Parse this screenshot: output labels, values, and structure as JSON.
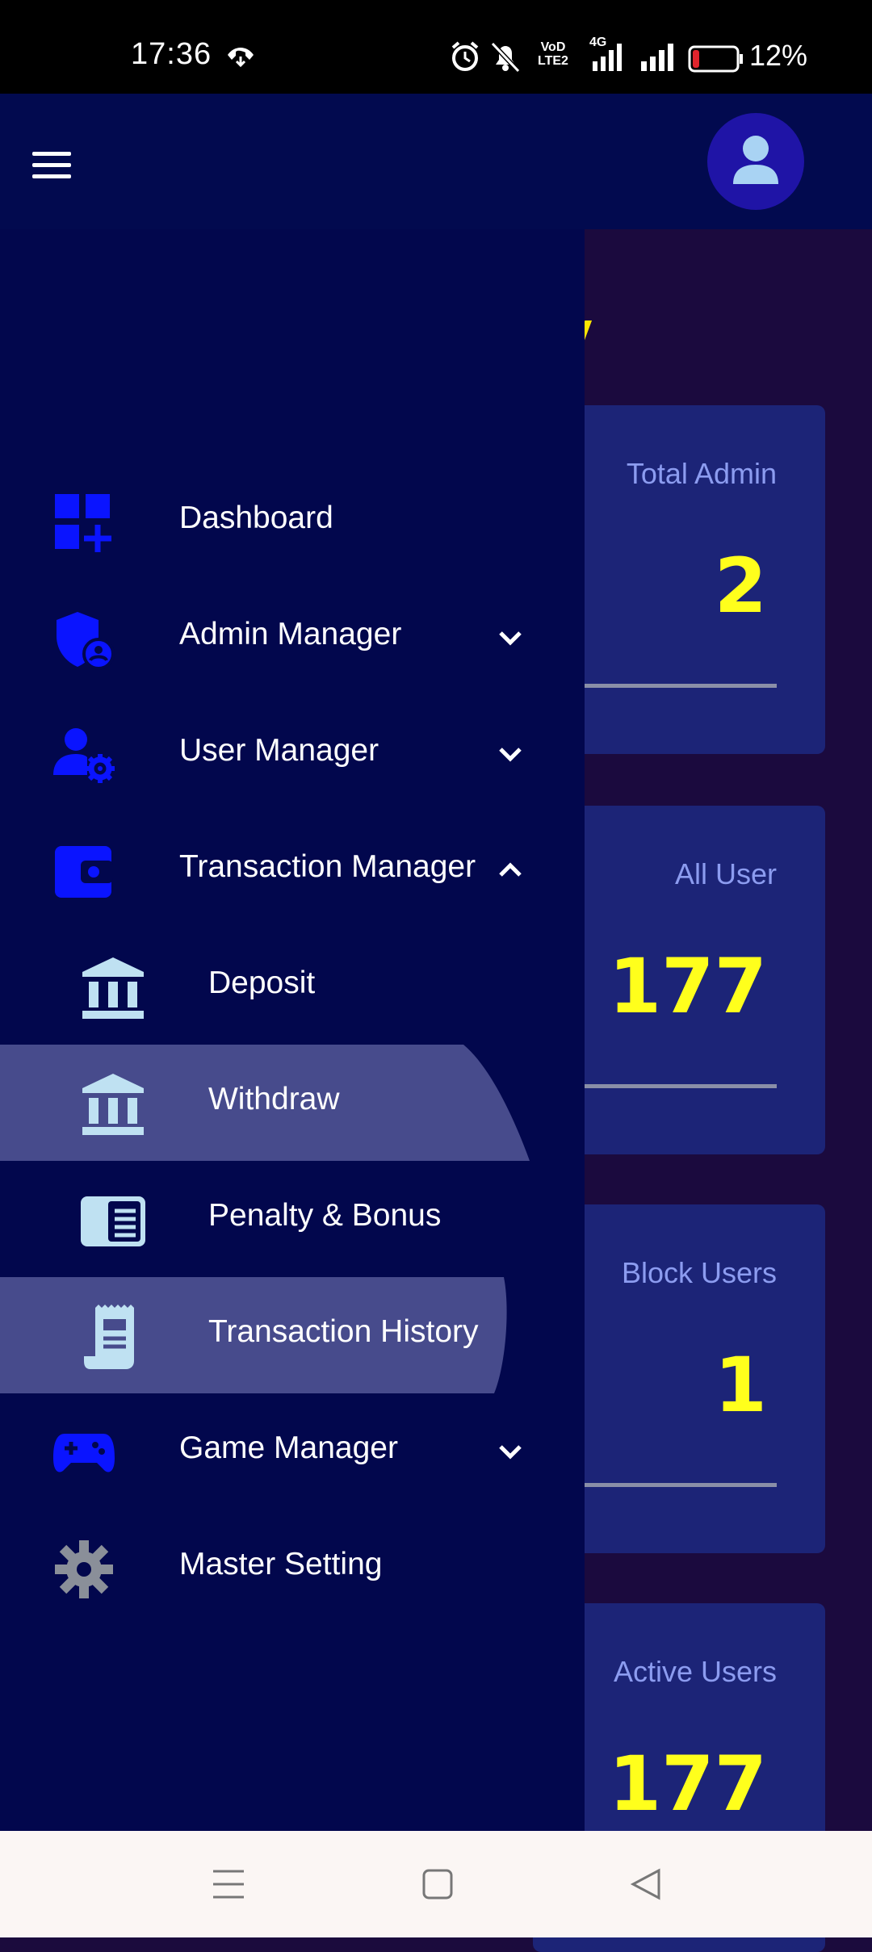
{
  "status_bar": {
    "time": "17:36",
    "network_label_top": "VoD",
    "network_label_bottom": "LTE2",
    "signal_label": "4G",
    "battery_percent": "12%",
    "battery_level": 0.12
  },
  "header": {
    "menu_icon": "hamburger-icon",
    "avatar_icon": "person-icon"
  },
  "dashboard": {
    "heading_fragment": "y",
    "cards": [
      {
        "label": "Total Admin",
        "value": "2"
      },
      {
        "label": "All User",
        "value": "177"
      },
      {
        "label": "Block Users",
        "value": "1"
      },
      {
        "label": "Active Users",
        "value": "177"
      }
    ]
  },
  "drawer": {
    "items": [
      {
        "label": "Dashboard",
        "icon": "dashboard-add-icon"
      },
      {
        "label": "Admin Manager",
        "icon": "admin-shield-icon",
        "expandable": true,
        "expanded": false
      },
      {
        "label": "User Manager",
        "icon": "user-settings-icon",
        "expandable": true,
        "expanded": false
      },
      {
        "label": "Transaction Manager",
        "icon": "wallet-icon",
        "expandable": true,
        "expanded": true
      },
      {
        "label": "Game Manager",
        "icon": "gamepad-icon",
        "expandable": true,
        "expanded": false
      },
      {
        "label": "Master Setting",
        "icon": "gear-icon"
      }
    ],
    "sub_items": [
      {
        "label": "Deposit",
        "icon": "bank-icon"
      },
      {
        "label": "Withdraw",
        "icon": "bank-icon",
        "active": true
      },
      {
        "label": "Penalty & Bonus",
        "icon": "book-icon"
      },
      {
        "label": "Transaction History",
        "icon": "receipt-icon",
        "active": true
      }
    ]
  },
  "colors": {
    "drawer_bg": "#02074d",
    "icon_blue": "#0a14ff",
    "sub_icon": "#bfe1f2",
    "card_value": "#ffff1c",
    "card_label": "#8c9cf0"
  }
}
